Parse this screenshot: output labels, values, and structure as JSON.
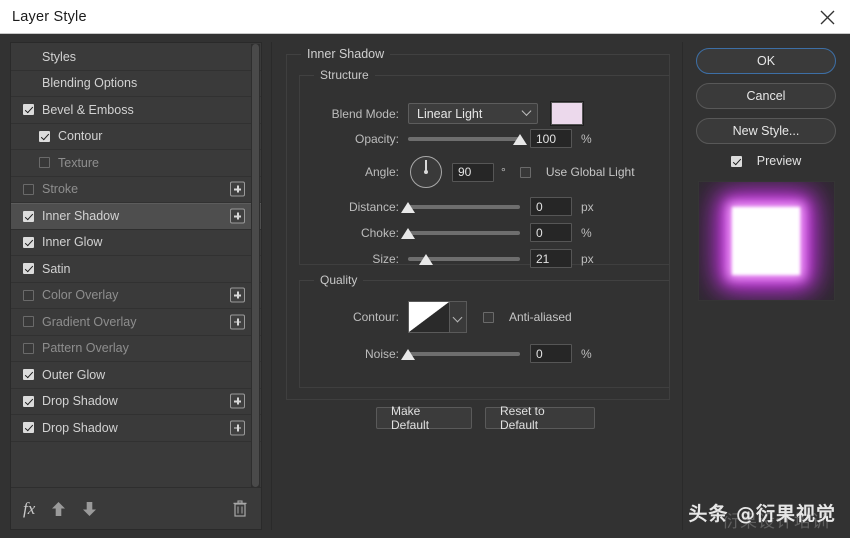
{
  "window": {
    "title": "Layer Style",
    "close_icon": "close-icon"
  },
  "sidebar": {
    "items": [
      {
        "label": "Styles",
        "checkbox": "none",
        "indent": false,
        "plus": false,
        "selected": false,
        "dim": false
      },
      {
        "label": "Blending Options",
        "checkbox": "none",
        "indent": false,
        "plus": false,
        "selected": false,
        "dim": false
      },
      {
        "label": "Bevel & Emboss",
        "checkbox": "checked",
        "indent": false,
        "plus": false,
        "selected": false,
        "dim": false
      },
      {
        "label": "Contour",
        "checkbox": "checked",
        "indent": true,
        "plus": false,
        "selected": false,
        "dim": false
      },
      {
        "label": "Texture",
        "checkbox": "unchecked",
        "indent": true,
        "plus": false,
        "selected": false,
        "dim": true
      },
      {
        "label": "Stroke",
        "checkbox": "unchecked",
        "indent": false,
        "plus": true,
        "selected": false,
        "dim": true
      },
      {
        "label": "Inner Shadow",
        "checkbox": "checked",
        "indent": false,
        "plus": true,
        "selected": true,
        "dim": false
      },
      {
        "label": "Inner Glow",
        "checkbox": "checked",
        "indent": false,
        "plus": false,
        "selected": false,
        "dim": false
      },
      {
        "label": "Satin",
        "checkbox": "checked",
        "indent": false,
        "plus": false,
        "selected": false,
        "dim": false
      },
      {
        "label": "Color Overlay",
        "checkbox": "unchecked",
        "indent": false,
        "plus": true,
        "selected": false,
        "dim": true
      },
      {
        "label": "Gradient Overlay",
        "checkbox": "unchecked",
        "indent": false,
        "plus": true,
        "selected": false,
        "dim": true
      },
      {
        "label": "Pattern Overlay",
        "checkbox": "unchecked",
        "indent": false,
        "plus": false,
        "selected": false,
        "dim": true
      },
      {
        "label": "Outer Glow",
        "checkbox": "checked",
        "indent": false,
        "plus": false,
        "selected": false,
        "dim": false
      },
      {
        "label": "Drop Shadow",
        "checkbox": "checked",
        "indent": false,
        "plus": true,
        "selected": false,
        "dim": false
      },
      {
        "label": "Drop Shadow",
        "checkbox": "checked",
        "indent": false,
        "plus": true,
        "selected": false,
        "dim": false
      }
    ],
    "footer": {
      "fx_label": "fx",
      "fx_icon": "fx-icon",
      "move_up_icon": "arrow-up-icon",
      "move_down_icon": "arrow-down-icon",
      "delete_icon": "trash-icon"
    }
  },
  "main": {
    "effect_title": "Inner Shadow",
    "structure": {
      "title": "Structure",
      "blend_mode_label": "Blend Mode:",
      "blend_mode_value": "Linear Light",
      "blend_mode_caret_icon": "chevron-down-icon",
      "color_swatch": "#ecd9ec",
      "opacity_label": "Opacity:",
      "opacity_value": "100",
      "opacity_unit": "%",
      "opacity_percent": 100,
      "angle_label": "Angle:",
      "angle_value": "90",
      "angle_unit": "°",
      "angle_degrees": 90,
      "use_global_light_label": "Use Global Light",
      "use_global_light_checked": false,
      "distance_label": "Distance:",
      "distance_value": "0",
      "distance_unit": "px",
      "distance_percent": 0,
      "choke_label": "Choke:",
      "choke_value": "0",
      "choke_unit": "%",
      "choke_percent": 0,
      "size_label": "Size:",
      "size_value": "21",
      "size_unit": "px",
      "size_percent": 16
    },
    "quality": {
      "title": "Quality",
      "contour_label": "Contour:",
      "contour_caret_icon": "chevron-down-icon",
      "anti_aliased_label": "Anti-aliased",
      "anti_aliased_checked": false,
      "noise_label": "Noise:",
      "noise_value": "0",
      "noise_unit": "%",
      "noise_percent": 0
    },
    "buttons": {
      "make_default": "Make Default",
      "reset_to_default": "Reset to Default"
    }
  },
  "rightcol": {
    "ok": "OK",
    "cancel": "Cancel",
    "new_style": "New Style...",
    "preview_label": "Preview",
    "preview_checked": true,
    "preview_thumbnail": "layer-effect-preview"
  },
  "watermark": {
    "main": "头条 @衍果视觉",
    "sub": "衍果设计培训"
  }
}
